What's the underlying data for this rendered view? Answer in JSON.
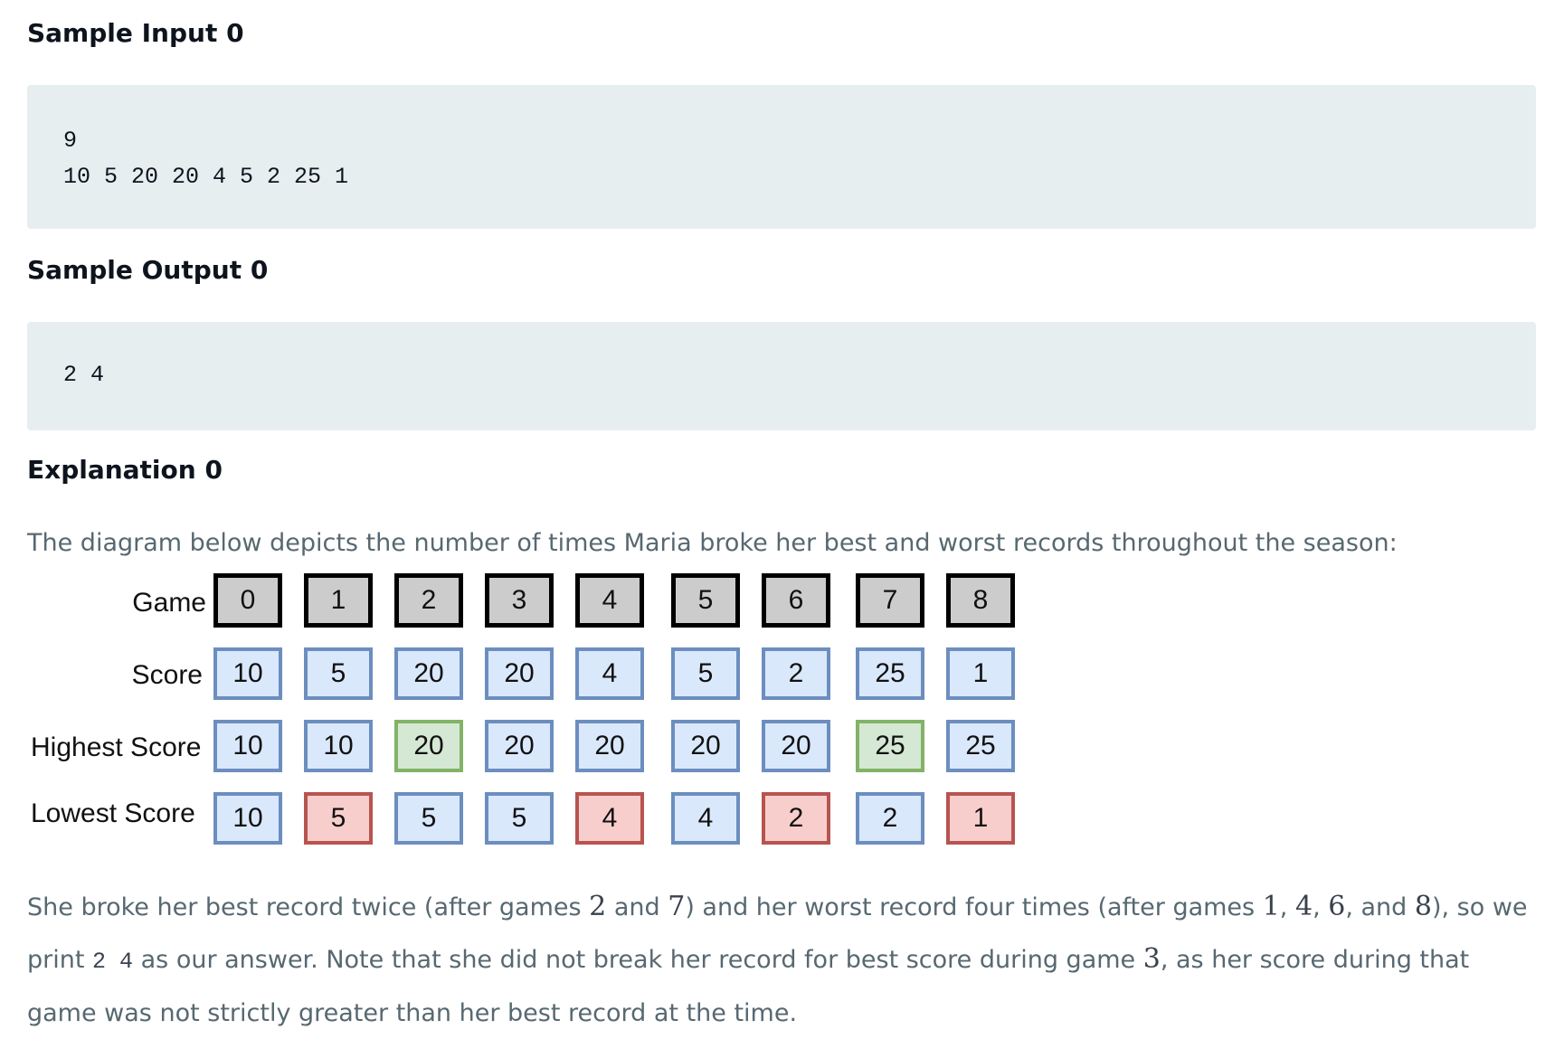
{
  "sample_input": {
    "heading": "Sample Input 0",
    "lines": [
      "9",
      "10 5 20 20 4 5 2 25 1"
    ]
  },
  "sample_output": {
    "heading": "Sample Output 0",
    "lines": [
      "2 4"
    ]
  },
  "explanation": {
    "heading": "Explanation 0",
    "intro": "The diagram below depicts the number of times Maria broke her best and worst records throughout the season:",
    "diagram": {
      "rows": [
        {
          "label": "Game",
          "kind": "game",
          "values": [
            "0",
            "1",
            "2",
            "3",
            "4",
            "5",
            "6",
            "7",
            "8"
          ]
        },
        {
          "label": "Score",
          "kind": "score",
          "values": [
            "10",
            "5",
            "20",
            "20",
            "4",
            "5",
            "2",
            "25",
            "1"
          ]
        },
        {
          "label": "Highest Score",
          "kind": "highest",
          "values": [
            "10",
            "10",
            "20",
            "20",
            "20",
            "20",
            "20",
            "25",
            "25"
          ],
          "highlight_indices": [
            2,
            7
          ]
        },
        {
          "label": "Lowest Score",
          "kind": "lowest",
          "values": [
            "10",
            "5",
            "5",
            "5",
            "4",
            "4",
            "2",
            "2",
            "1"
          ],
          "highlight_indices": [
            1,
            4,
            6,
            8
          ]
        }
      ],
      "colors": {
        "default_fill": "#dae8fc",
        "default_border": "#6c8ebf",
        "game_fill": "#cccccc",
        "game_border": "#000000",
        "best_fill": "#d5e8d4",
        "best_border": "#82b366",
        "worst_fill": "#f8cecc",
        "worst_border": "#b85450"
      }
    },
    "conclusion": {
      "t1": "She broke her best record twice (after games ",
      "n1": "2",
      "t2": " and ",
      "n2": "7",
      "t3": ") and her worst record four times (after games ",
      "n3": "1",
      "t4": ", ",
      "n4": "4",
      "t5": ", ",
      "n5": "6",
      "t6": ", and ",
      "n6": "8",
      "t7": "), so we print ",
      "code": "2 4",
      "t8": " as our answer. Note that she did not break her record for best score during game ",
      "n7": "3",
      "t9": ", as her score during that game was not strictly greater than her best record at the time."
    }
  }
}
